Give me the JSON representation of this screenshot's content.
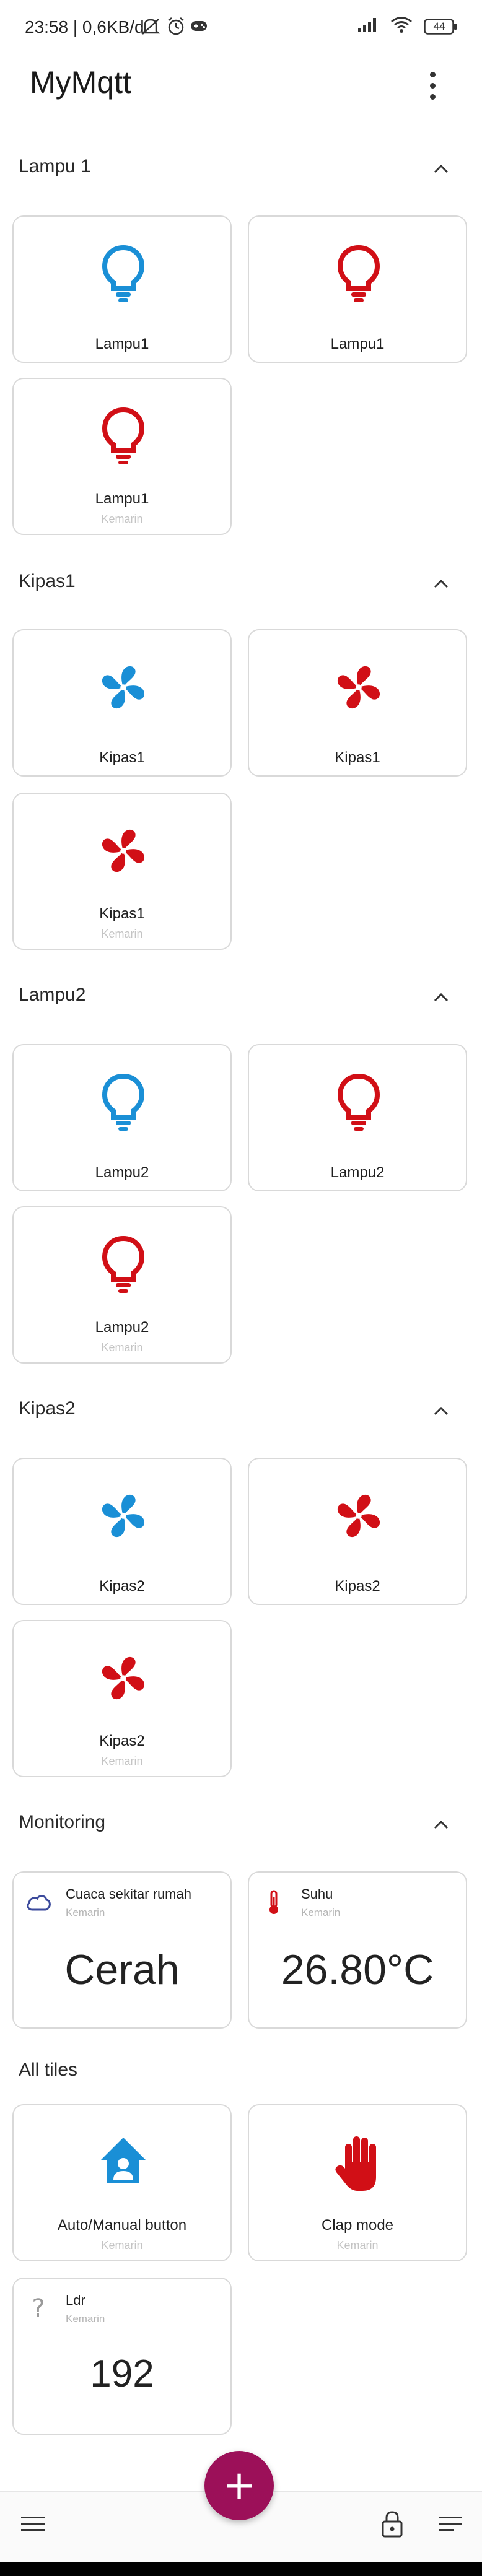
{
  "status_bar": {
    "text": "23:58 | 0,6KB/d",
    "battery": "44"
  },
  "app": {
    "title": "MyMqtt"
  },
  "sections": {
    "lampu1": {
      "title": "Lampu 1"
    },
    "kipas1": {
      "title": "Kipas1"
    },
    "lampu2": {
      "title": "Lampu2"
    },
    "kipas2": {
      "title": "Kipas2"
    },
    "monitoring": {
      "title": "Monitoring"
    },
    "alltiles": {
      "title": "All tiles"
    }
  },
  "tiles": {
    "lampu1_a": {
      "label": "Lampu1",
      "icon": "lightbulb-icon",
      "color": "#1a8fd6"
    },
    "lampu1_b": {
      "label": "Lampu1",
      "icon": "lightbulb-icon",
      "color": "#d10f16"
    },
    "lampu1_c": {
      "label": "Lampu1",
      "sub": "Kemarin",
      "icon": "lightbulb-icon",
      "color": "#d10f16"
    },
    "kipas1_a": {
      "label": "Kipas1",
      "icon": "fan-icon",
      "color": "#1a8fd6"
    },
    "kipas1_b": {
      "label": "Kipas1",
      "icon": "fan-icon",
      "color": "#d10f16"
    },
    "kipas1_c": {
      "label": "Kipas1",
      "sub": "Kemarin",
      "icon": "fan-icon",
      "color": "#d10f16"
    },
    "lampu2_a": {
      "label": "Lampu2",
      "icon": "lightbulb-icon",
      "color": "#1a8fd6"
    },
    "lampu2_b": {
      "label": "Lampu2",
      "icon": "lightbulb-icon",
      "color": "#d10f16"
    },
    "lampu2_c": {
      "label": "Lampu2",
      "sub": "Kemarin",
      "icon": "lightbulb-icon",
      "color": "#d10f16"
    },
    "kipas2_a": {
      "label": "Kipas2",
      "icon": "fan-icon",
      "color": "#1a8fd6"
    },
    "kipas2_b": {
      "label": "Kipas2",
      "icon": "fan-icon",
      "color": "#d10f16"
    },
    "kipas2_c": {
      "label": "Kipas2",
      "sub": "Kemarin",
      "icon": "fan-icon",
      "color": "#d10f16"
    }
  },
  "monitoring": {
    "weather": {
      "title": "Cuaca sekitar rumah",
      "sub": "Kemarin",
      "value": "Cerah",
      "icon": "cloud-icon"
    },
    "temp": {
      "title": "Suhu",
      "sub": "Kemarin",
      "value": "26.80°C",
      "icon": "thermometer-icon"
    }
  },
  "all_tiles": {
    "auto": {
      "label": "Auto/Manual button",
      "sub": "Kemarin",
      "icon": "home-user-icon",
      "color": "#1a8fd6"
    },
    "clap": {
      "label": "Clap mode",
      "sub": "Kemarin",
      "icon": "hand-icon",
      "color": "#d10f16"
    },
    "ldr": {
      "title": "Ldr",
      "sub": "Kemarin",
      "value": "192",
      "icon": "question-icon"
    }
  },
  "fab": {
    "label": "+"
  }
}
